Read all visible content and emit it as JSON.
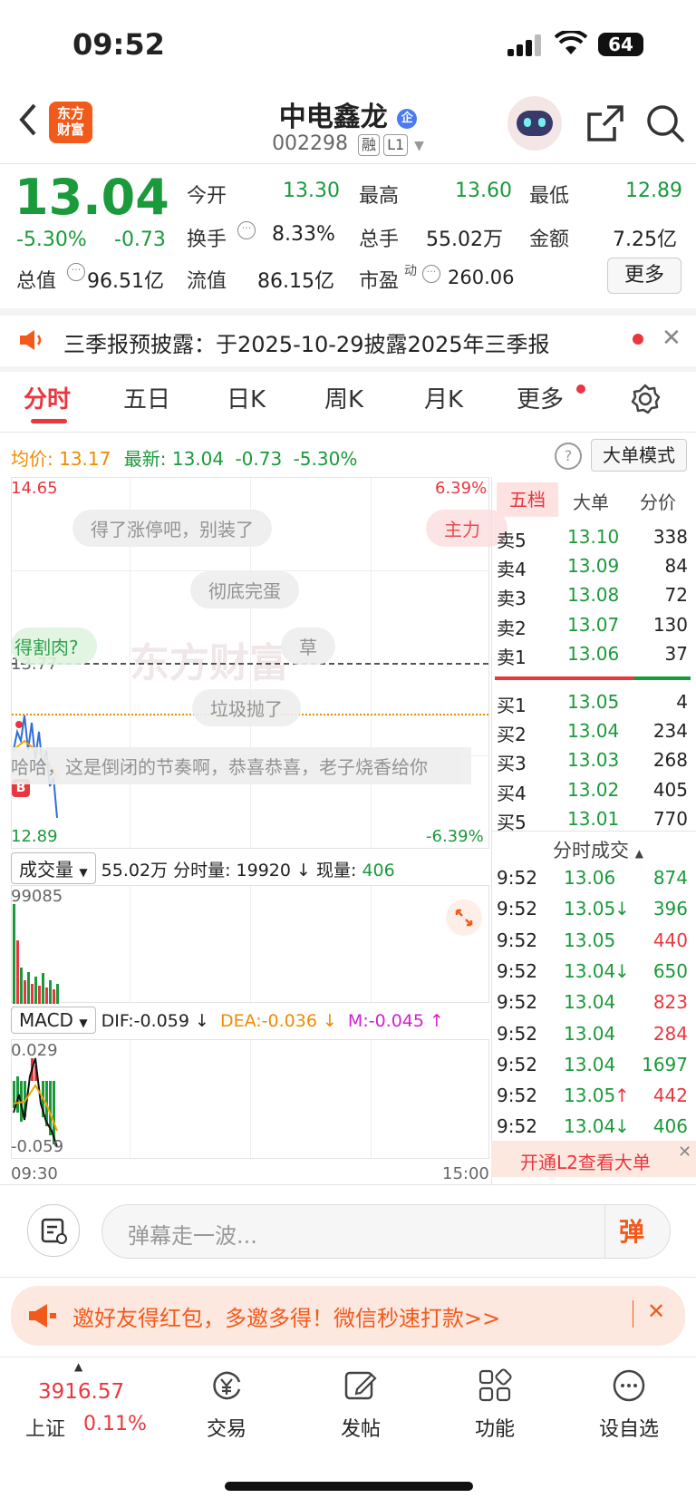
{
  "status_bar": {
    "time": "09:52",
    "battery": "64"
  },
  "header": {
    "logo_text": "东方\n财富",
    "stock_name": "中电鑫龙",
    "badge": "企",
    "stock_code": "002298",
    "tag_margin": "融",
    "tag_level": "L1"
  },
  "quote": {
    "price": "13.04",
    "change_pct": "-5.30%",
    "change": "-0.73",
    "open_label": "今开",
    "open": "13.30",
    "high_label": "最高",
    "high": "13.60",
    "low_label": "最低",
    "low": "12.89",
    "turnover_label": "换手",
    "turnover": "8.33%",
    "volume_label": "总手",
    "volume": "55.02万",
    "amount_label": "金额",
    "amount": "7.25亿",
    "mcap_label": "总值",
    "mcap": "96.51亿",
    "float_label": "流值",
    "float_mcap": "86.15亿",
    "pe_label": "市盈",
    "pe_sup": "动",
    "pe": "260.06",
    "more_button": "更多"
  },
  "notice": {
    "text": "三季报预披露：于2025-10-29披露2025年三季报"
  },
  "tabs": [
    "分时",
    "五日",
    "日K",
    "周K",
    "月K",
    "更多"
  ],
  "chart_header": {
    "avg_label": "均价:",
    "avg": "13.17",
    "latest_label": "最新:",
    "latest": "13.04",
    "change": "-0.73",
    "pct": "-5.30%",
    "big_order_mode": "大单模式"
  },
  "price_chart": {
    "y_top": "14.65",
    "y_bottom": "12.89",
    "pct_top": "6.39%",
    "pct_bottom": "-6.39%",
    "prev_close": "13.77",
    "t_start": "09:30",
    "t_end": "15:00",
    "logo_watermark": "东方财富",
    "marker": "B"
  },
  "danmaku": [
    "得了涨停吧，别装了",
    "主力",
    "彻底完蛋",
    "得割肉?",
    "草",
    "垃圾抛了",
    "哈哈，这是倒闭的节奏啊，恭喜恭喜，老子烧香给你"
  ],
  "volume_bar": {
    "selector": "成交量",
    "total": "55.02万",
    "minute_label": "分时量:",
    "minute_vol": "19920",
    "arrow": "↓",
    "current_label": "现量:",
    "current": "406",
    "max": "99085"
  },
  "macd_bar": {
    "selector": "MACD",
    "dif": "DIF:-0.059 ↓",
    "dea": "DEA:-0.036 ↓",
    "m": "M:-0.045 ↑",
    "top": "0.029",
    "bottom": "-0.059"
  },
  "depth_tabs": [
    "五档",
    "大单",
    "分价"
  ],
  "asks": [
    {
      "label": "卖5",
      "price": "13.10",
      "vol": "338"
    },
    {
      "label": "卖4",
      "price": "13.09",
      "vol": "84"
    },
    {
      "label": "卖3",
      "price": "13.08",
      "vol": "72"
    },
    {
      "label": "卖2",
      "price": "13.07",
      "vol": "130"
    },
    {
      "label": "卖1",
      "price": "13.06",
      "vol": "37"
    }
  ],
  "bids": [
    {
      "label": "买1",
      "price": "13.05",
      "vol": "4"
    },
    {
      "label": "买2",
      "price": "13.04",
      "vol": "234"
    },
    {
      "label": "买3",
      "price": "13.03",
      "vol": "268"
    },
    {
      "label": "买4",
      "price": "13.02",
      "vol": "405"
    },
    {
      "label": "买5",
      "price": "13.01",
      "vol": "770"
    }
  ],
  "ticks_title": "分时成交",
  "ticks": [
    {
      "time": "9:52",
      "price": "13.06",
      "arrow": "",
      "vol": "874",
      "vc": "green"
    },
    {
      "time": "9:52",
      "price": "13.05",
      "arrow": "↓",
      "vol": "396",
      "vc": "green"
    },
    {
      "time": "9:52",
      "price": "13.05",
      "arrow": "",
      "vol": "440",
      "vc": "red"
    },
    {
      "time": "9:52",
      "price": "13.04",
      "arrow": "↓",
      "vol": "650",
      "vc": "green"
    },
    {
      "time": "9:52",
      "price": "13.04",
      "arrow": "",
      "vol": "823",
      "vc": "red"
    },
    {
      "time": "9:52",
      "price": "13.04",
      "arrow": "",
      "vol": "284",
      "vc": "red"
    },
    {
      "time": "9:52",
      "price": "13.04",
      "arrow": "",
      "vol": "1697",
      "vc": "green"
    },
    {
      "time": "9:52",
      "price": "13.05",
      "arrow": "↑",
      "vol": "442",
      "vc": "red"
    },
    {
      "time": "9:52",
      "price": "13.04",
      "arrow": "↓",
      "vol": "406",
      "vc": "green"
    }
  ],
  "l2_promo": "开通L2查看大单",
  "comment_bar": {
    "placeholder": "弹幕走一波...",
    "danmaku_button": "弹"
  },
  "invite_banner": {
    "text": "邀好友得红包，多邀多得！微信秒速打款>>"
  },
  "bottom_nav": {
    "index_value": "3916.57",
    "index_name": "上证",
    "index_pct": "0.11%",
    "items": [
      "交易",
      "发帖",
      "功能",
      "设自选"
    ]
  },
  "colors": {
    "up": "#e8373e",
    "down": "#1a9a3a",
    "accent": "#f25a1b",
    "avg_line": "#f0a500"
  }
}
